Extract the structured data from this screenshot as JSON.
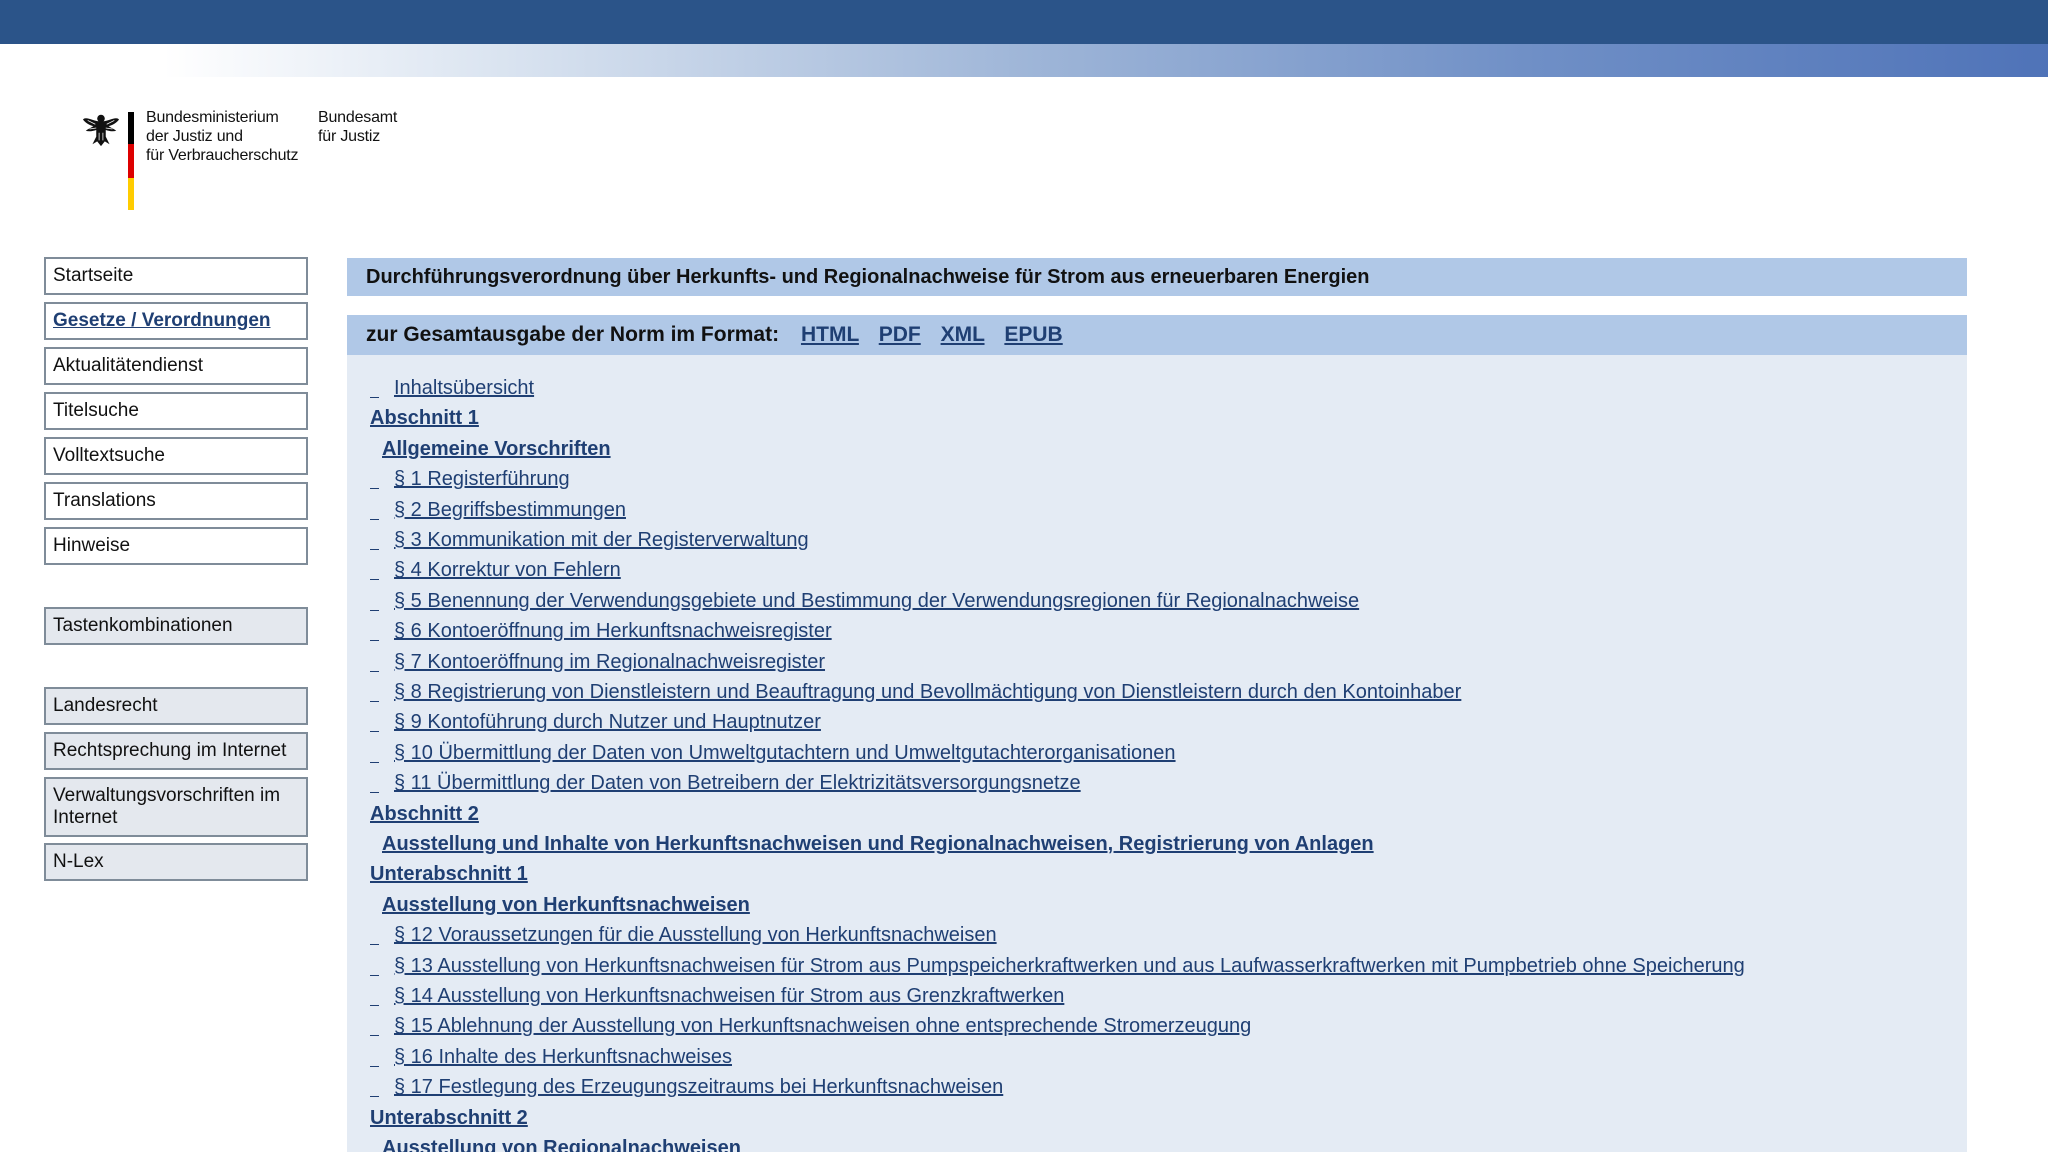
{
  "header": {
    "ministry_lines": [
      "Bundesministerium",
      "der Justiz und",
      "für Verbraucherschutz"
    ],
    "office_lines": [
      "Bundesamt",
      "für Justiz"
    ]
  },
  "nav": {
    "group1": [
      "Startseite",
      "Gesetze / Verordnungen",
      "Aktualitätendienst",
      "Titelsuche",
      "Volltextsuche",
      "Translations",
      "Hinweise"
    ],
    "group2": [
      "Tastenkombinationen"
    ],
    "group3": [
      "Landesrecht",
      "Rechtsprechung im Internet",
      "Verwaltungsvorschriften im Internet",
      "N-Lex"
    ],
    "active": "Gesetze / Verordnungen"
  },
  "main": {
    "title": "Durchführungsverordnung über Herkunfts- und Regionalnachweise für Strom aus erneuerbaren Energien",
    "format_label": "zur Gesamtausgabe der Norm im Format:",
    "formats": [
      "HTML",
      "PDF",
      "XML",
      "EPUB"
    ],
    "toc": [
      {
        "text": "Inhaltsübersicht",
        "type": "item"
      },
      {
        "text": "Abschnitt 1",
        "type": "section"
      },
      {
        "text": "Allgemeine Vorschriften",
        "type": "section-title"
      },
      {
        "text": "§ 1 Registerführung",
        "type": "item"
      },
      {
        "text": "§ 2 Begriffsbestimmungen",
        "type": "item"
      },
      {
        "text": "§ 3 Kommunikation mit der Registerverwaltung",
        "type": "item"
      },
      {
        "text": "§ 4 Korrektur von Fehlern",
        "type": "item"
      },
      {
        "text": "§ 5 Benennung der Verwendungsgebiete und Bestimmung der Verwendungsregionen für Regionalnachweise",
        "type": "item"
      },
      {
        "text": "§ 6 Kontoeröffnung im Herkunftsnachweisregister",
        "type": "item"
      },
      {
        "text": "§ 7 Kontoeröffnung im Regionalnachweisregister",
        "type": "item"
      },
      {
        "text": "§ 8 Registrierung von Dienstleistern und Beauftragung und Bevollmächtigung von Dienstleistern durch den Kontoinhaber",
        "type": "item"
      },
      {
        "text": "§ 9 Kontoführung durch Nutzer und Hauptnutzer",
        "type": "item"
      },
      {
        "text": "§ 10 Übermittlung der Daten von Umweltgutachtern und Umweltgutachterorganisationen",
        "type": "item"
      },
      {
        "text": "§ 11 Übermittlung der Daten von Betreibern der Elektrizitätsversorgungsnetze",
        "type": "item"
      },
      {
        "text": "Abschnitt 2",
        "type": "section"
      },
      {
        "text": "Ausstellung und Inhalte von Herkunftsnachweisen und Regionalnachweisen, Registrierung von Anlagen",
        "type": "section-title"
      },
      {
        "text": "Unterabschnitt 1",
        "type": "section"
      },
      {
        "text": "Ausstellung von Herkunftsnachweisen",
        "type": "section-title"
      },
      {
        "text": "§ 12 Voraussetzungen für die Ausstellung von Herkunftsnachweisen",
        "type": "item"
      },
      {
        "text": "§ 13 Ausstellung von Herkunftsnachweisen für Strom aus Pumpspeicherkraftwerken und aus Laufwasserkraftwerken mit Pumpbetrieb ohne Speicherung",
        "type": "item"
      },
      {
        "text": "§ 14 Ausstellung von Herkunftsnachweisen für Strom aus Grenzkraftwerken",
        "type": "item"
      },
      {
        "text": "§ 15 Ablehnung der Ausstellung von Herkunftsnachweisen ohne entsprechende Stromerzeugung",
        "type": "item"
      },
      {
        "text": "§ 16 Inhalte des Herkunftsnachweises",
        "type": "item"
      },
      {
        "text": "§ 17 Festlegung des Erzeugungszeitraums bei Herkunftsnachweisen",
        "type": "item"
      },
      {
        "text": "Unterabschnitt 2",
        "type": "section"
      },
      {
        "text": "Ausstellung von Regionalnachweisen",
        "type": "section-title"
      }
    ]
  }
}
